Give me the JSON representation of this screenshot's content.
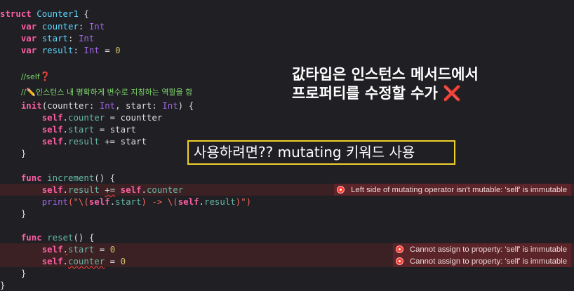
{
  "code": {
    "l01_kw": "struct",
    "l01_name": "Counter1",
    "l01_brace": " {",
    "l02_kw": "var",
    "l02_prop": "counter",
    "l02_type": "Int",
    "l03_kw": "var",
    "l03_prop": "start",
    "l03_type": "Int",
    "l04_kw": "var",
    "l04_prop": "result",
    "l04_type": "Int",
    "l04_val": "0",
    "l06_comment": "//self",
    "l06_mark": "❓",
    "l07_comment": "//",
    "l07_emoji": "✏️",
    "l07_text": "인스턴스 내 명확하게 변수로 지칭하는 역할을 함",
    "l08_kw": "init",
    "l08_sig_a": "(countter: ",
    "l08_type_a": "Int",
    "l08_sig_b": ", start: ",
    "l08_type_b": "Int",
    "l08_sig_c": ") {",
    "l09_self": "self",
    "l09_prop": "counter",
    "l09_rest": " = countter",
    "l10_self": "self",
    "l10_prop": "start",
    "l10_rest": " = start",
    "l11_self": "self",
    "l11_prop": "result",
    "l11_rest": " += start",
    "l12": "}",
    "l14_kw": "func",
    "l14_name": "increment",
    "l14_rest": "() {",
    "l15_self": "self",
    "l15_prop": "result",
    "l15_op": "+=",
    "l15_self2": "self",
    "l15_prop2": "counter",
    "l16_fn": "print",
    "l16_str_a": "(\"\\(",
    "l16_self": "self",
    "l16_prop": "start",
    "l16_str_b": ") -> \\(",
    "l16_self2": "self",
    "l16_prop2": "result",
    "l16_str_c": ")\")",
    "l17": "}",
    "l19_kw": "func",
    "l19_name": "reset",
    "l19_rest": "() {",
    "l20_self": "self",
    "l20_prop": "start",
    "l20_val": "0",
    "l21_self": "self",
    "l21_prop": "counter",
    "l21_val": "0",
    "l22": "}",
    "l23": "}"
  },
  "errors": {
    "increment_error": "Left side of mutating operator isn't mutable: 'self' is immutable",
    "reset_start_error": "Cannot assign to property: 'self' is immutable",
    "reset_counter_error": "Cannot assign to property: 'self' is immutable"
  },
  "annotations": {
    "note_line1": "값타입은 인스턴스 메서드에서",
    "note_line2_text": "프로퍼티를 수정할 수가",
    "note_line2_mark": "❌",
    "callout": "사용하려면?? mutating 키워드 사용"
  },
  "colors": {
    "background": "#1f1f24",
    "keyword": "#fc5fa3",
    "type": "#5dd8ff",
    "property": "#67b7a4",
    "number": "#d0bf69",
    "error": "#ff3b30",
    "callout_border": "#f0d02b"
  },
  "icons": {
    "error_icon": "error-circle-icon"
  }
}
